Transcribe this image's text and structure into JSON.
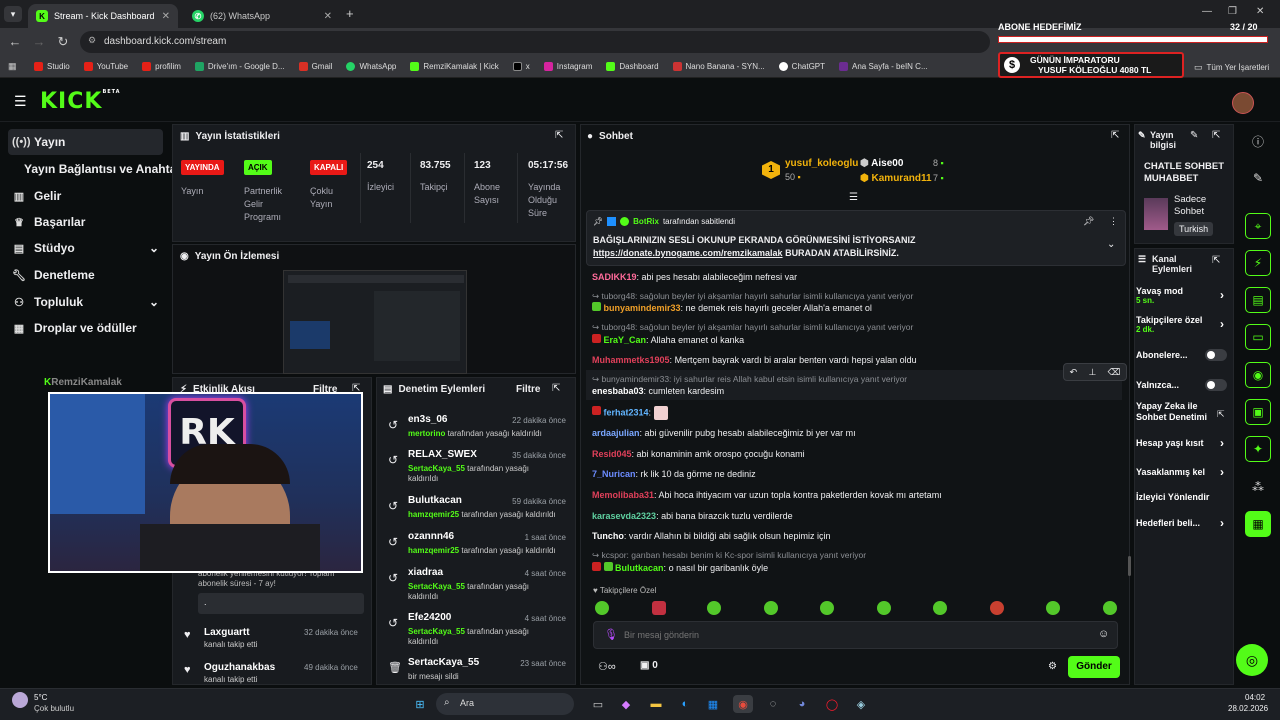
{
  "browser": {
    "tabs": [
      {
        "title": "Stream - Kick Dashboard",
        "active": true
      },
      {
        "title": "(62) WhatsApp",
        "active": false
      }
    ],
    "new_tab": "+",
    "url": "dashboard.kick.com/stream",
    "bookmarks": [
      "Studio",
      "YouTube",
      "profilim",
      "Drive'ım - Google D...",
      "Gmail",
      "WhatsApp",
      "RemziKamalak | Kick",
      "x",
      "Instagram",
      "Dashboard",
      "Nano Banana - SYN...",
      "ChatGPT",
      "Ana Sayfa - beIN C..."
    ],
    "all_bookmarks": "Tüm Yer İşaretleri"
  },
  "overlay": {
    "goal_label": "ABONE HEDEFİMİZ",
    "goal_progress": "32  / 20",
    "emperor_line1": "GÜNÜN İMPARATORU",
    "emperor_line2": "YUSUF KÖLEOĞLU 4080 TL",
    "watermark": "RemziKamalak"
  },
  "kick": {
    "logo": "KICK",
    "beta": "BETA"
  },
  "sidebar": [
    {
      "label": "Yayın",
      "icon": "broadcast-icon",
      "active": true
    },
    {
      "label": "Yayın Bağlantısı ve Anahtarı",
      "icon": ""
    },
    {
      "label": "Gelir",
      "icon": "money-icon"
    },
    {
      "label": "Başarılar",
      "icon": "trophy-icon"
    },
    {
      "label": "Stüdyo",
      "icon": "studio-icon",
      "chevron": true
    },
    {
      "label": "Denetleme",
      "icon": "wrench-icon"
    },
    {
      "label": "Topluluk",
      "icon": "community-icon",
      "chevron": true
    },
    {
      "label": "Droplar ve ödüller",
      "icon": "gift-icon"
    }
  ],
  "stats": {
    "title": "Yayın İstatistikleri",
    "badges": [
      {
        "text": "YAYINDA",
        "label": "Yayın",
        "color": "#e91916"
      },
      {
        "text": "AÇIK",
        "label": "Partnerlik Gelir Programı",
        "color": "#53fc18"
      },
      {
        "text": "KAPALI",
        "label": "Çoklu Yayın",
        "color": "#e91916"
      }
    ],
    "numbers": [
      {
        "value": "254",
        "label": "İzleyici"
      },
      {
        "value": "83.755",
        "label": "Takipçi"
      },
      {
        "value": "123",
        "label": "Abone Sayısı"
      },
      {
        "value": "05:17:56",
        "label": "Yayında Olduğu Süre"
      }
    ]
  },
  "preview": {
    "title": "Yayın Ön İzlemesi"
  },
  "activity": {
    "title": "Etkinlik Akışı",
    "filter": "Filtre",
    "partial_text": "abonelik yenilemesini kutluyor! Toplam abonelik süresi - 7 ay!",
    "dot": ".",
    "items": [
      {
        "name": "Laxguartt",
        "time": "32 dakika önce",
        "text": "kanalı takip etti"
      },
      {
        "name": "Oguzhanakbas",
        "time": "49 dakika önce",
        "text": "kanalı takip etti"
      }
    ]
  },
  "moderation": {
    "title": "Denetim Eylemleri",
    "filter": "Filtre",
    "items": [
      {
        "name": "en3s_06",
        "time": "22 dakika önce",
        "by": "mertorino",
        "text": "tarafından yasağı kaldırıldı"
      },
      {
        "name": "RELAX_SWEX",
        "time": "35 dakika önce",
        "by": "SertacKaya_55",
        "text": "tarafından yasağı kaldırıldı"
      },
      {
        "name": "Bulutkacan",
        "time": "59 dakika önce",
        "by": "hamzqemir25",
        "text": "tarafından yasağı kaldırıldı"
      },
      {
        "name": "ozannn46",
        "time": "1 saat önce",
        "by": "hamzqemir25",
        "text": "tarafından yasağı kaldırıldı"
      },
      {
        "name": "xiadraa",
        "time": "4 saat önce",
        "by": "SertacKaya_55",
        "text": "tarafından yasağı kaldırıldı"
      },
      {
        "name": "Efe24200",
        "time": "4 saat önce",
        "by": "SertacKaya_55",
        "text": "tarafından yasağı kaldırıldı"
      },
      {
        "name": "SertacKaya_55",
        "time": "23 saat önce",
        "by": "",
        "text": "bir mesajı sildi"
      }
    ]
  },
  "chat": {
    "title": "Sohbet",
    "top_gifters": [
      {
        "rank": "1",
        "name": "yusuf_koleoglu",
        "count": "50"
      },
      {
        "name": "Aise00",
        "count": "8"
      },
      {
        "name": "Kamurand11",
        "count": "7"
      }
    ],
    "pinned": {
      "by": "BotRix",
      "by_suffix": "tarafından sabitlendi",
      "line1": "BAĞIŞLARINIZIN SESLİ OKUNUP EKRANDA GÖRÜNMESİNİ İSTİYORSANIZ",
      "link": "https://donate.bynogame.com/remzikamalak",
      "line2_rest": " BURADAN ATABİLİRSİNİZ."
    },
    "messages": [
      {
        "user": "SADIKK19",
        "color": "#ff6b9a",
        "text": "abi pes hesabı alabileceğim nefresi var"
      },
      {
        "reply": "tuborg48: sağolun beyler iyi akşamlar hayırlı sahurlar isimli kullanıcıya yanıt veriyor"
      },
      {
        "user": "bunyamindemir33",
        "color": "#f0a028",
        "text": "ne demek reis hayırlı geceler Allah'a emanet ol"
      },
      {
        "reply": "tuborg48: sağolun beyler iyi akşamlar hayırlı sahurlar isimli kullanıcıya yanıt veriyor"
      },
      {
        "user": "EraY_Can",
        "color": "#53fc18",
        "text": "Allaha emanet ol kanka"
      },
      {
        "user": "Muhammetks1905",
        "color": "#e0405a",
        "text": "Mertçem bayrak vardı bi aralar benten vardı hepsi yalan oldu"
      },
      {
        "reply": "bunyamindemir33: iyi sahurlar reis Allah kabul etsin isimli kullanıcıya yanıt veriyor"
      },
      {
        "user": "enesbaba03",
        "color": "#ffffff",
        "text": "cumleten kardesim"
      },
      {
        "user": "ferhat2314",
        "color": "#62b5ff",
        "text": ""
      },
      {
        "user": "ardaajulian",
        "color": "#7aa7ff",
        "text": "abi güvenilir pubg hesabı alabileceğimiz bi yer var mı"
      },
      {
        "user": "Resid045",
        "color": "#e0405a",
        "text": "abi konaminin amk orospo çocuğu konami"
      },
      {
        "user": "7_Nurican",
        "color": "#6c8cff",
        "text": "rk lik 10 da görme ne dediniz"
      },
      {
        "user": "Memolibaba31",
        "color": "#e0405a",
        "text": "Abi hoca ihtiyacım var uzun topla kontra paketlerden kovak mı artetamı"
      },
      {
        "user": "karasevda2323",
        "color": "#5fd0a0",
        "text": "abi bana birazcık tuzlu verdilerde"
      },
      {
        "user": "Tuncho",
        "color": "#ffffff",
        "text": "vardır Allahın bi bildiği abi sağlık olsun hepimiz için"
      },
      {
        "reply": "kcspor: garıban hesabı benim ki Kc-spor isimli kullanıcıya yanıt veriyor"
      },
      {
        "user": "Bulutkacan",
        "color": "#53fc18",
        "text": "o nasıl bir garibanlık öyle"
      }
    ],
    "emote_tab": "Takipçilere Özel",
    "input_placeholder": "Bir mesaj gönderin",
    "points": "0",
    "send": "Gönder"
  },
  "stream_info": {
    "title": "Yayın bilgisi",
    "stream_title": "CHATLE SOHBET MUHABBET",
    "category": "Sadece Sohbet",
    "language": "Turkish"
  },
  "channel_actions": {
    "title": "Kanal Eylemleri",
    "items": [
      {
        "label": "Yavaş mod",
        "sub": "5 sn.",
        "type": "chevron"
      },
      {
        "label": "Takipçilere özel",
        "sub": "2 dk.",
        "type": "chevron"
      },
      {
        "label": "Abonelere...",
        "type": "toggle"
      },
      {
        "label": "Yalnızca...",
        "type": "toggle"
      },
      {
        "label": "Yapay Zeka ile Sohbet Denetimi",
        "type": "external"
      },
      {
        "label": "Hesap yaşı kısıt",
        "type": "chevron"
      },
      {
        "label": "Yasaklanmış kel",
        "type": "chevron"
      },
      {
        "label": "İzleyici Yönlendir",
        "type": "none"
      },
      {
        "label": "Hedefleri beli...",
        "type": "chevron"
      }
    ]
  },
  "taskbar": {
    "weather_temp": "5°C",
    "weather_desc": "Çok bulutlu",
    "search": "Ara",
    "time": "04:02",
    "date": "28.02.2026"
  },
  "colors": {
    "kick_green": "#53fc18",
    "live_red": "#e91916",
    "panel_bg": "#181b1f"
  }
}
